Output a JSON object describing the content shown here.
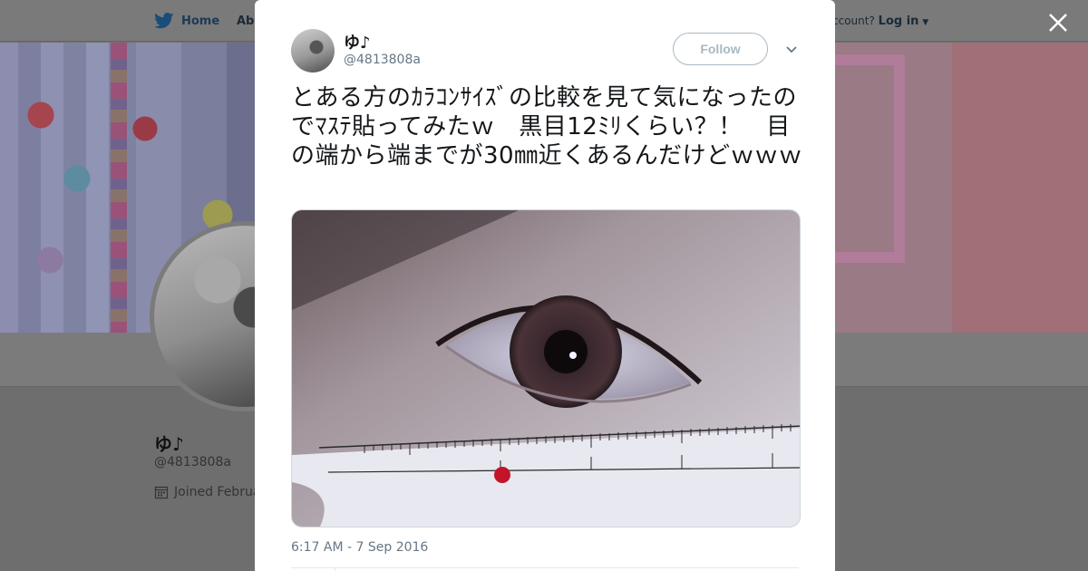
{
  "nav": {
    "home_label": "Home",
    "about_label": "Abo",
    "account_prompt": "ccount?",
    "login_label": "Log in"
  },
  "profile": {
    "name": "ゆ♪",
    "handle": "@4813808a",
    "joined": "Joined Februa"
  },
  "tweet": {
    "display_name": "ゆ♪",
    "username": "@4813808a",
    "follow_label": "Follow",
    "text": "とある方のｶﾗｺﾝｻｲｽﾞの比較を見て気になったのでﾏｽﾃ貼ってみたｗ　黒目12ﾐﾘくらい？！　目の端から端までが30㎜近くあるんだけどｗｗｗ",
    "timestamp": "6:17 AM - 7 Sep 2016"
  },
  "icons": {
    "twitter_bird": "twitter-bird-icon",
    "close": "close-icon",
    "caret": "caret-down-icon",
    "chevron": "chevron-down-icon",
    "calendar": "calendar-icon"
  },
  "colors": {
    "twitter_blue": "#1da1f2",
    "follow_border": "#aab8c2",
    "muted_text": "#657786",
    "text": "#14171a"
  }
}
